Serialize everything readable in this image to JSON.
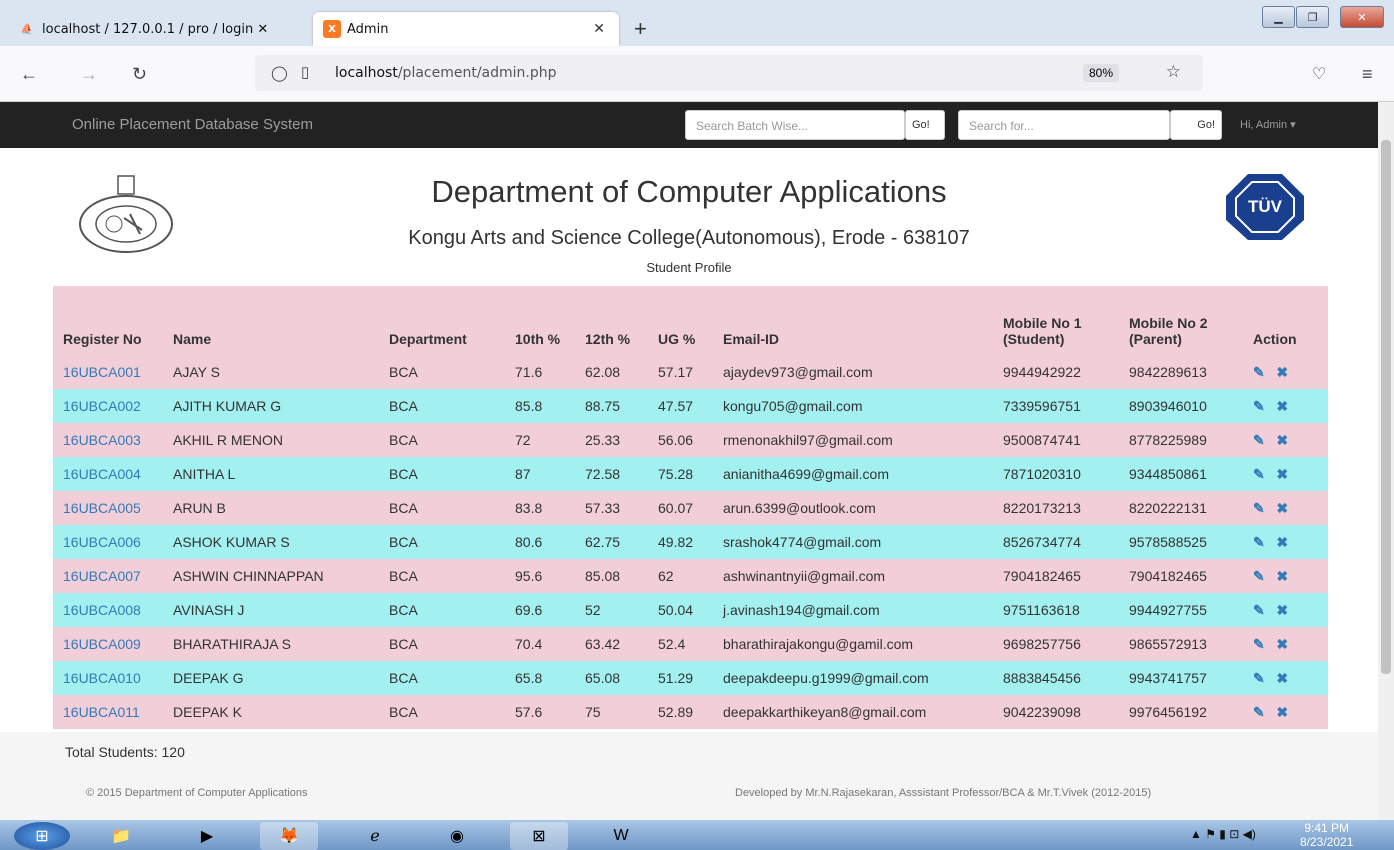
{
  "browser": {
    "tabs": [
      {
        "label": "localhost / 127.0.0.1 / pro / login ✕"
      },
      {
        "label": "Admin"
      }
    ],
    "url_host": "localhost",
    "url_path": "/placement/admin.php",
    "zoom": "80%"
  },
  "topbar": {
    "brand": "Online Placement Database System",
    "search_batch_placeholder": "Search Batch Wise...",
    "search_placeholder": "Search for...",
    "go_label": "Go!",
    "user_label": "Hi, Admin ▾"
  },
  "header": {
    "title": "Department of Computer Applications",
    "subtitle": "Kongu Arts and Science College(Autonomous), Erode - 638107",
    "section": "Student Profile",
    "logo_text": "TÜV"
  },
  "table": {
    "columns": [
      "Register No",
      "Name",
      "Department",
      "10th %",
      "12th %",
      "UG %",
      "Email-ID",
      "Mobile No 1 (Student)",
      "Mobile No 2 (Parent)",
      "Action"
    ],
    "rows": [
      [
        "16UBCA001",
        "AJAY S",
        "BCA",
        "71.6",
        "62.08",
        "57.17",
        "ajaydev973@gmail.com",
        "9944942922",
        "9842289613"
      ],
      [
        "16UBCA002",
        "AJITH KUMAR G",
        "BCA",
        "85.8",
        "88.75",
        "47.57",
        "kongu705@gmail.com",
        "7339596751",
        "8903946010"
      ],
      [
        "16UBCA003",
        "AKHIL R MENON",
        "BCA",
        "72",
        "25.33",
        "56.06",
        "rmenonakhil97@gmail.com",
        "9500874741",
        "8778225989"
      ],
      [
        "16UBCA004",
        "ANITHA L",
        "BCA",
        "87",
        "72.58",
        "75.28",
        "anianitha4699@gmail.com",
        "7871020310",
        "9344850861"
      ],
      [
        "16UBCA005",
        "ARUN B",
        "BCA",
        "83.8",
        "57.33",
        "60.07",
        "arun.6399@outlook.com",
        "8220173213",
        "8220222131"
      ],
      [
        "16UBCA006",
        "ASHOK KUMAR S",
        "BCA",
        "80.6",
        "62.75",
        "49.82",
        "srashok4774@gmail.com",
        "8526734774",
        "9578588525"
      ],
      [
        "16UBCA007",
        "ASHWIN CHINNAPPAN",
        "BCA",
        "95.6",
        "85.08",
        "62",
        "ashwinantnyii@gmail.com",
        "7904182465",
        "7904182465"
      ],
      [
        "16UBCA008",
        "AVINASH J",
        "BCA",
        "69.6",
        "52",
        "50.04",
        "j.avinash194@gmail.com",
        "9751163618",
        "9944927755"
      ],
      [
        "16UBCA009",
        "BHARATHIRAJA S",
        "BCA",
        "70.4",
        "63.42",
        "52.4",
        "bharathirajakongu@gamil.com",
        "9698257756",
        "9865572913"
      ],
      [
        "16UBCA010",
        "DEEPAK G",
        "BCA",
        "65.8",
        "65.08",
        "51.29",
        "deepakdeepu.g1999@gmail.com",
        "8883845456",
        "9943741757"
      ],
      [
        "16UBCA011",
        "DEEPAK K",
        "BCA",
        "57.6",
        "75",
        "52.89",
        "deepakkarthikeyan8@gmail.com",
        "9042239098",
        "9976456192"
      ]
    ]
  },
  "footer": {
    "total": "Total Students: 120",
    "copyright": "© 2015 Department of Computer Applications",
    "developed": "Developed by Mr.N.Rajasekaran, Asssistant Professor/BCA & Mr.T.Vivek (2012-2015)"
  },
  "taskbar": {
    "time": "9:41 PM",
    "date": "8/23/2021"
  }
}
